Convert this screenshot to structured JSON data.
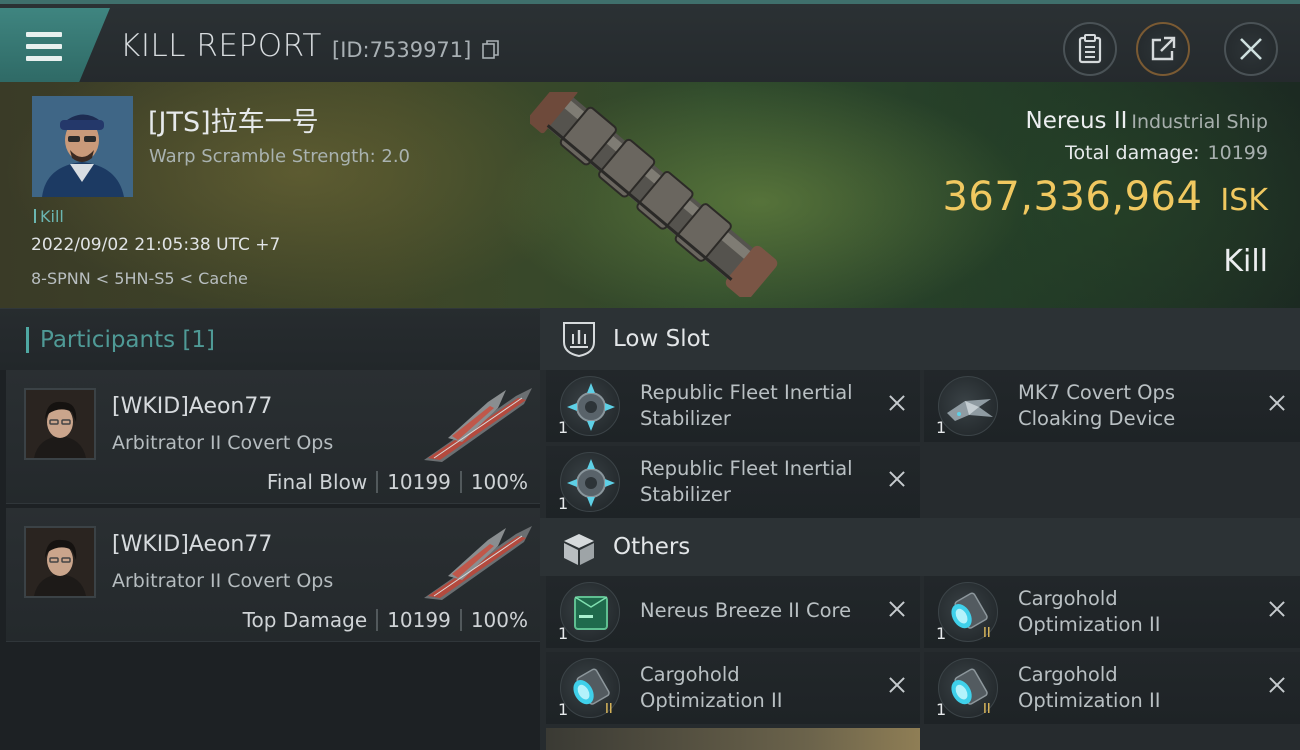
{
  "window": {
    "title": "KILL REPORT",
    "report_id": "[ID:7539971]"
  },
  "icons": {
    "menu": "hamburger-menu-icon",
    "copy": "copy-icon",
    "clipboard": "clipboard-icon",
    "share": "share-external-icon",
    "close": "close-icon",
    "low_slot": "low-slot-icon",
    "others": "cargo-box-icon",
    "remove": "remove-x-icon"
  },
  "colors": {
    "accent": "#4fa8a3",
    "isk": "#f0c860"
  },
  "victim": {
    "name": "[JTS]拉车一号",
    "warp_scramble": "Warp Scramble Strength: 2.0",
    "kill_tag": "Kill",
    "datetime": "2022/09/02 21:05:38 UTC +7",
    "location": "8-SPNN < 5HN-S5 < Cache",
    "ship_name": "Nereus II",
    "ship_class": "Industrial Ship",
    "total_damage_label": "Total damage:",
    "total_damage": "10199",
    "isk_value": "367,336,964",
    "isk_unit": "ISK",
    "result": "Kill"
  },
  "participants": {
    "header": "Participants [1]",
    "rows": [
      {
        "name": "[WKID]Aeon77",
        "ship": "Arbitrator II Covert Ops",
        "role": "Final Blow",
        "damage": "10199",
        "percent": "100%"
      },
      {
        "name": "[WKID]Aeon77",
        "ship": "Arbitrator II Covert Ops",
        "role": "Top Damage",
        "damage": "10199",
        "percent": "100%"
      }
    ]
  },
  "low_slot": {
    "title": "Low Slot",
    "items": [
      {
        "name": "Republic Fleet Inertial Stabilizer",
        "qty": "1"
      },
      {
        "name": "MK7 Covert Ops Cloaking Device",
        "qty": "1"
      },
      {
        "name": "Republic Fleet Inertial Stabilizer",
        "qty": "1"
      }
    ]
  },
  "others": {
    "title": "Others",
    "items": [
      {
        "name": "Nereus Breeze II Core",
        "qty": "1"
      },
      {
        "name": "Cargohold Optimization II",
        "qty": "1"
      },
      {
        "name": "Cargohold Optimization II",
        "qty": "1"
      },
      {
        "name": "Cargohold Optimization II",
        "qty": "1"
      }
    ]
  }
}
